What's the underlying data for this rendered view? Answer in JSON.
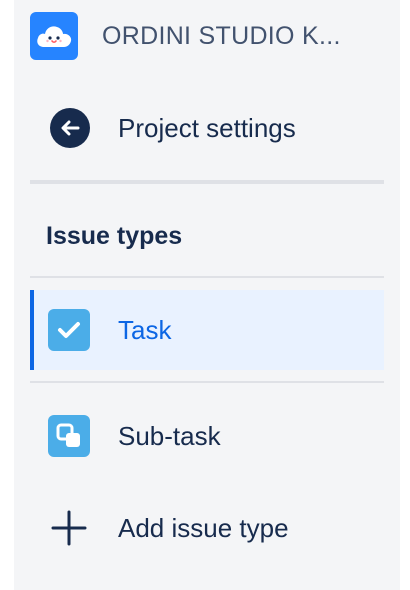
{
  "project": {
    "name": "ORDINI STUDIO K...",
    "avatar_icon": "cloud-avatar-icon",
    "accent_color": "#2684ff"
  },
  "back": {
    "label": "Project settings",
    "icon": "arrow-left-icon"
  },
  "section": {
    "heading": "Issue types"
  },
  "issue_types": [
    {
      "label": "Task",
      "icon": "checkbox-check-icon",
      "selected": true
    },
    {
      "label": "Sub-task",
      "icon": "subtask-icon",
      "selected": false
    }
  ],
  "add_action": {
    "label": "Add issue type",
    "icon": "plus-icon"
  },
  "colors": {
    "selected_bg": "#e9f2ff",
    "selected_accent": "#0c66e4",
    "issue_icon_bg": "#4bade8"
  }
}
